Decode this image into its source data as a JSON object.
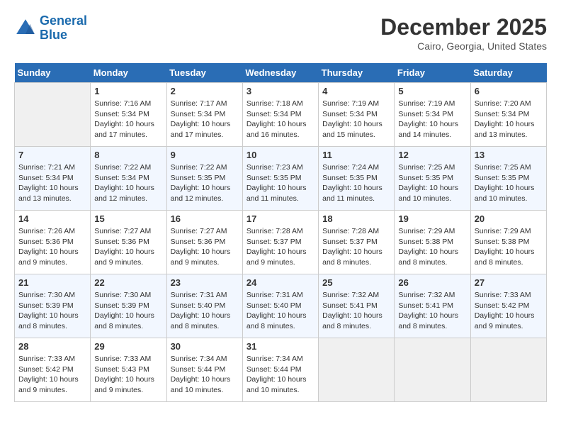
{
  "header": {
    "logo_line1": "General",
    "logo_line2": "Blue",
    "month": "December 2025",
    "location": "Cairo, Georgia, United States"
  },
  "weekdays": [
    "Sunday",
    "Monday",
    "Tuesday",
    "Wednesday",
    "Thursday",
    "Friday",
    "Saturday"
  ],
  "weeks": [
    [
      {
        "day": "",
        "empty": true
      },
      {
        "day": "1",
        "sunrise": "7:16 AM",
        "sunset": "5:34 PM",
        "daylight": "10 hours and 17 minutes."
      },
      {
        "day": "2",
        "sunrise": "7:17 AM",
        "sunset": "5:34 PM",
        "daylight": "10 hours and 17 minutes."
      },
      {
        "day": "3",
        "sunrise": "7:18 AM",
        "sunset": "5:34 PM",
        "daylight": "10 hours and 16 minutes."
      },
      {
        "day": "4",
        "sunrise": "7:19 AM",
        "sunset": "5:34 PM",
        "daylight": "10 hours and 15 minutes."
      },
      {
        "day": "5",
        "sunrise": "7:19 AM",
        "sunset": "5:34 PM",
        "daylight": "10 hours and 14 minutes."
      },
      {
        "day": "6",
        "sunrise": "7:20 AM",
        "sunset": "5:34 PM",
        "daylight": "10 hours and 13 minutes."
      }
    ],
    [
      {
        "day": "7",
        "sunrise": "7:21 AM",
        "sunset": "5:34 PM",
        "daylight": "10 hours and 13 minutes."
      },
      {
        "day": "8",
        "sunrise": "7:22 AM",
        "sunset": "5:34 PM",
        "daylight": "10 hours and 12 minutes."
      },
      {
        "day": "9",
        "sunrise": "7:22 AM",
        "sunset": "5:35 PM",
        "daylight": "10 hours and 12 minutes."
      },
      {
        "day": "10",
        "sunrise": "7:23 AM",
        "sunset": "5:35 PM",
        "daylight": "10 hours and 11 minutes."
      },
      {
        "day": "11",
        "sunrise": "7:24 AM",
        "sunset": "5:35 PM",
        "daylight": "10 hours and 11 minutes."
      },
      {
        "day": "12",
        "sunrise": "7:25 AM",
        "sunset": "5:35 PM",
        "daylight": "10 hours and 10 minutes."
      },
      {
        "day": "13",
        "sunrise": "7:25 AM",
        "sunset": "5:35 PM",
        "daylight": "10 hours and 10 minutes."
      }
    ],
    [
      {
        "day": "14",
        "sunrise": "7:26 AM",
        "sunset": "5:36 PM",
        "daylight": "10 hours and 9 minutes."
      },
      {
        "day": "15",
        "sunrise": "7:27 AM",
        "sunset": "5:36 PM",
        "daylight": "10 hours and 9 minutes."
      },
      {
        "day": "16",
        "sunrise": "7:27 AM",
        "sunset": "5:36 PM",
        "daylight": "10 hours and 9 minutes."
      },
      {
        "day": "17",
        "sunrise": "7:28 AM",
        "sunset": "5:37 PM",
        "daylight": "10 hours and 9 minutes."
      },
      {
        "day": "18",
        "sunrise": "7:28 AM",
        "sunset": "5:37 PM",
        "daylight": "10 hours and 8 minutes."
      },
      {
        "day": "19",
        "sunrise": "7:29 AM",
        "sunset": "5:38 PM",
        "daylight": "10 hours and 8 minutes."
      },
      {
        "day": "20",
        "sunrise": "7:29 AM",
        "sunset": "5:38 PM",
        "daylight": "10 hours and 8 minutes."
      }
    ],
    [
      {
        "day": "21",
        "sunrise": "7:30 AM",
        "sunset": "5:39 PM",
        "daylight": "10 hours and 8 minutes."
      },
      {
        "day": "22",
        "sunrise": "7:30 AM",
        "sunset": "5:39 PM",
        "daylight": "10 hours and 8 minutes."
      },
      {
        "day": "23",
        "sunrise": "7:31 AM",
        "sunset": "5:40 PM",
        "daylight": "10 hours and 8 minutes."
      },
      {
        "day": "24",
        "sunrise": "7:31 AM",
        "sunset": "5:40 PM",
        "daylight": "10 hours and 8 minutes."
      },
      {
        "day": "25",
        "sunrise": "7:32 AM",
        "sunset": "5:41 PM",
        "daylight": "10 hours and 8 minutes."
      },
      {
        "day": "26",
        "sunrise": "7:32 AM",
        "sunset": "5:41 PM",
        "daylight": "10 hours and 8 minutes."
      },
      {
        "day": "27",
        "sunrise": "7:33 AM",
        "sunset": "5:42 PM",
        "daylight": "10 hours and 9 minutes."
      }
    ],
    [
      {
        "day": "28",
        "sunrise": "7:33 AM",
        "sunset": "5:42 PM",
        "daylight": "10 hours and 9 minutes."
      },
      {
        "day": "29",
        "sunrise": "7:33 AM",
        "sunset": "5:43 PM",
        "daylight": "10 hours and 9 minutes."
      },
      {
        "day": "30",
        "sunrise": "7:34 AM",
        "sunset": "5:44 PM",
        "daylight": "10 hours and 10 minutes."
      },
      {
        "day": "31",
        "sunrise": "7:34 AM",
        "sunset": "5:44 PM",
        "daylight": "10 hours and 10 minutes."
      },
      {
        "day": "",
        "empty": true
      },
      {
        "day": "",
        "empty": true
      },
      {
        "day": "",
        "empty": true
      }
    ]
  ]
}
